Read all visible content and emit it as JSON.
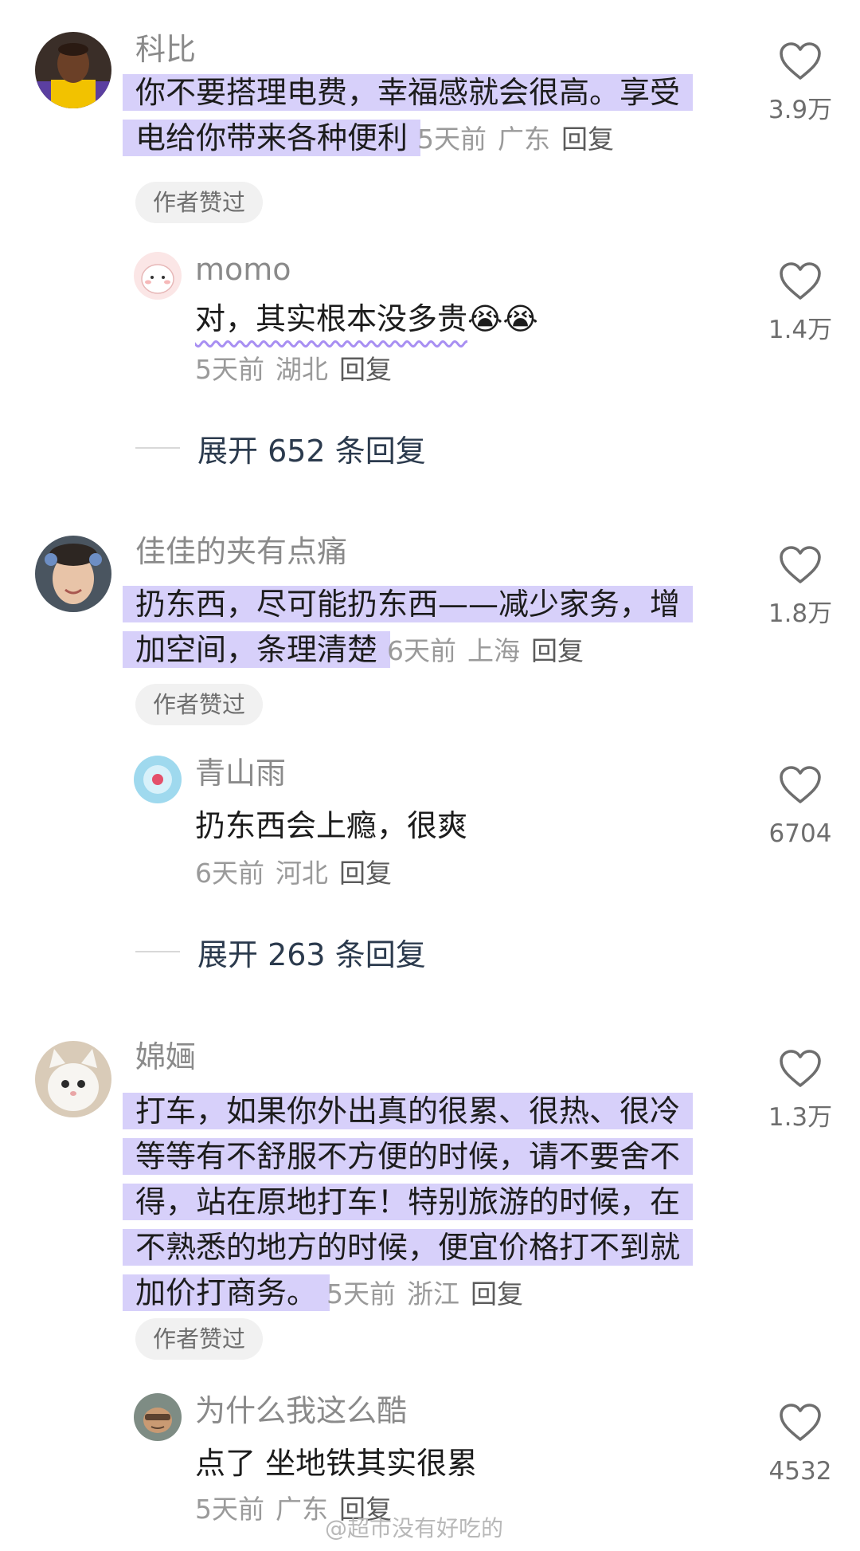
{
  "comments": [
    {
      "user": "科比",
      "text": "你不要搭理电费，幸福感就会很高。享受电给你带来各种便利",
      "time": "5天前",
      "location": "广东",
      "reply_label": "回复",
      "likes": "3.9万",
      "badge": "作者赞过",
      "reply": {
        "user": "momo",
        "text": "对，其实根本没多贵",
        "emoji": "😭😭",
        "time": "5天前",
        "location": "湖北",
        "reply_label": "回复",
        "likes": "1.4万"
      },
      "expand": "展开 652 条回复"
    },
    {
      "user": "佳佳的夹有点痛",
      "text": "扔东西，尽可能扔东西——减少家务，增加空间，条理清楚",
      "time": "6天前",
      "location": "上海",
      "reply_label": "回复",
      "likes": "1.8万",
      "badge": "作者赞过",
      "reply": {
        "user": "青山雨",
        "text": "扔东西会上瘾，很爽",
        "time": "6天前",
        "location": "河北",
        "reply_label": "回复",
        "likes": "6704"
      },
      "expand": "展开 263 条回复"
    },
    {
      "user": "婂婳",
      "text": "打车，如果你外出真的很累、很热、很冷等等有不舒服不方便的时候，请不要舍不得，站在原地打车！特别旅游的时候，在不熟悉的地方的时候，便宜价格打不到就加价打商务。",
      "time": "5天前",
      "location": "浙江",
      "reply_label": "回复",
      "likes": "1.3万",
      "badge": "作者赞过",
      "reply": {
        "user": "为什么我这么酷",
        "text": "点了 坐地铁其实很累",
        "time": "5天前",
        "location": "广东",
        "reply_label": "回复",
        "likes": "4532"
      }
    }
  ],
  "watermark": "@超市没有好吃的",
  "colors": {
    "highlight": "#d7d0fa",
    "username": "#8a8a8a",
    "meta": "#9a9a9a",
    "expand_text": "#2b3a4d",
    "badge_bg": "#f1f1f1"
  }
}
